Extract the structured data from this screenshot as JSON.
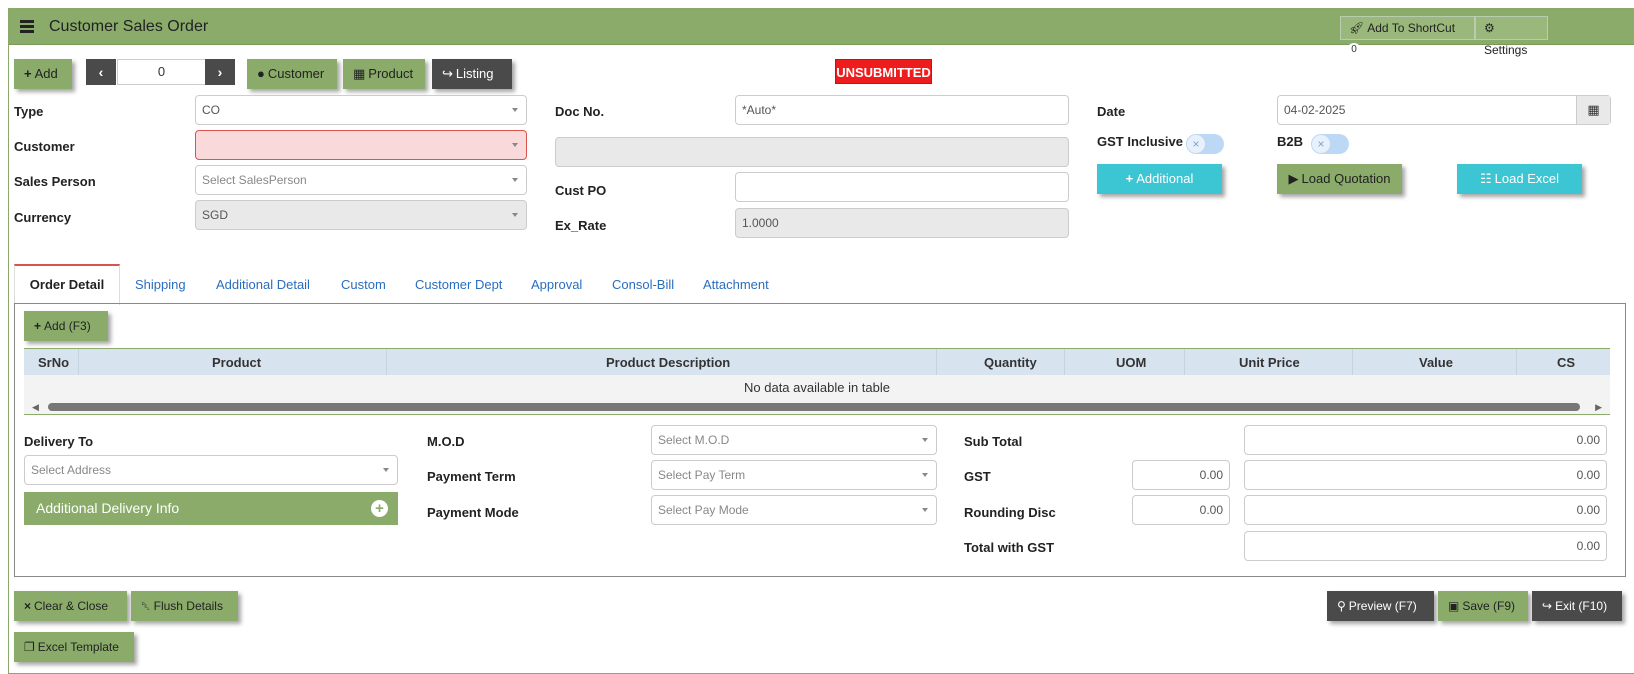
{
  "header": {
    "title": "Customer Sales Order",
    "shortcut_label": "Add To ShortCut",
    "shortcut_count": "0",
    "settings_label": "Settings"
  },
  "toolbar": {
    "add_label": "Add",
    "record_index": "0",
    "customer_label": "Customer",
    "product_label": "Product",
    "listing_label": "Listing"
  },
  "status": "UNSUBMITTED",
  "form": {
    "type_label": "Type",
    "type_value": "CO",
    "customer_label": "Customer",
    "customer_value": "",
    "salesperson_label": "Sales Person",
    "salesperson_placeholder": "Select SalesPerson",
    "currency_label": "Currency",
    "currency_value": "SGD",
    "docno_label": "Doc No.",
    "docno_value": "*Auto*",
    "custpo_label": "Cust PO",
    "custpo_value": "",
    "exrate_label": "Ex_Rate",
    "exrate_value": "1.0000",
    "date_label": "Date",
    "date_value": "04-02-2025",
    "gst_inclusive_label": "GST Inclusive",
    "b2b_label": "B2B"
  },
  "actions": {
    "additional_label": "Additional",
    "load_quotation_label": "Load Quotation",
    "load_excel_label": "Load Excel"
  },
  "tabs": [
    {
      "label": "Order Detail"
    },
    {
      "label": "Shipping"
    },
    {
      "label": "Additional Detail"
    },
    {
      "label": "Custom"
    },
    {
      "label": "Customer Dept"
    },
    {
      "label": "Approval"
    },
    {
      "label": "Consol-Bill"
    },
    {
      "label": "Attachment"
    }
  ],
  "detail": {
    "add_label": "Add (F3)",
    "columns": [
      "SrNo",
      "Product",
      "Product Description",
      "Quantity",
      "UOM",
      "Unit Price",
      "Value",
      "CS"
    ],
    "empty_text": "No data available in table"
  },
  "delivery": {
    "label": "Delivery To",
    "address_placeholder": "Select Address",
    "additional_info_label": "Additional Delivery Info"
  },
  "terms": {
    "mod_label": "M.O.D",
    "mod_placeholder": "Select M.O.D",
    "payterm_label": "Payment Term",
    "payterm_placeholder": "Select Pay Term",
    "paymode_label": "Payment Mode",
    "paymode_placeholder": "Select Pay Mode"
  },
  "totals": {
    "subtotal_label": "Sub Total",
    "subtotal_value": "0.00",
    "gst_label": "GST",
    "gst_rate": "0.00",
    "gst_value": "0.00",
    "rounding_label": "Rounding Disc",
    "rounding_rate": "0.00",
    "rounding_value": "0.00",
    "total_label": "Total with GST",
    "total_value": "0.00"
  },
  "footer": {
    "clear_label": "Clear & Close",
    "flush_label": "Flush Details",
    "excel_template_label": "Excel Template",
    "preview_label": "Preview (F7)",
    "save_label": "Save (F9)",
    "exit_label": "Exit (F10)"
  }
}
